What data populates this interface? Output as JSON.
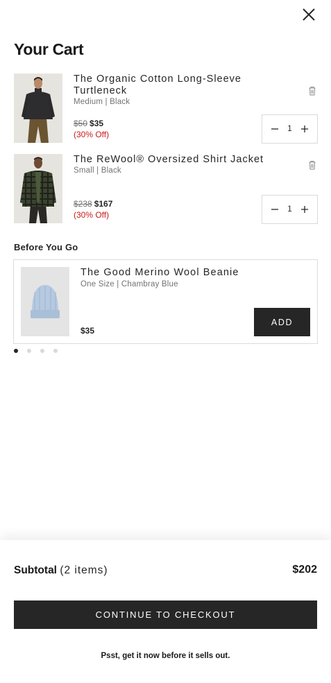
{
  "cart": {
    "title": "Your Cart",
    "items": [
      {
        "name": "The Organic Cotton Long-Sleeve Turtleneck",
        "variant": "Medium | Black",
        "original_price": "$50",
        "sale_price": "$35",
        "discount": "(30% Off)",
        "quantity": "1"
      },
      {
        "name": "The ReWool® Oversized Shirt Jacket",
        "variant": "Small | Black",
        "original_price": "$238",
        "sale_price": "$167",
        "discount": "(30% Off)",
        "quantity": "1"
      }
    ]
  },
  "upsell": {
    "heading": "Before You Go",
    "product": {
      "name": "The Good Merino Wool Beanie",
      "variant": "One Size | Chambray Blue",
      "price": "$35",
      "add_label": "ADD"
    },
    "carousel_dots": 4,
    "active_dot": 0
  },
  "footer": {
    "subtotal_label": "Subtotal",
    "subtotal_count": "(2 items)",
    "subtotal_value": "$202",
    "checkout_label": "CONTINUE TO CHECKOUT",
    "urgency_text": "Psst, get it now before it sells out."
  },
  "icons": {
    "close": "close-icon",
    "trash": "trash-icon",
    "minus": "minus-icon",
    "plus": "plus-icon"
  },
  "colors": {
    "primary_dark": "#262626",
    "sale_red": "#c71c1c",
    "muted_text": "#737373",
    "border": "#d9d9d9"
  }
}
